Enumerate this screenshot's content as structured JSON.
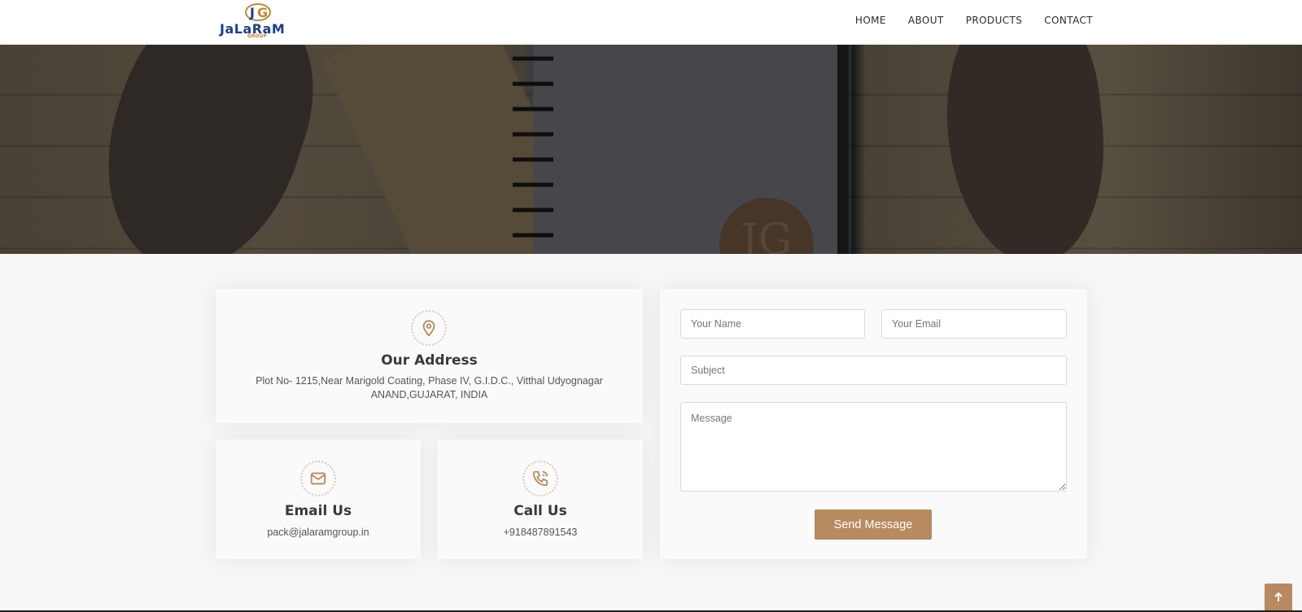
{
  "brand": {
    "name": "JaLaRaM",
    "sub": "GROUP",
    "monogram": "JG"
  },
  "nav": {
    "items": [
      "HOME",
      "ABOUT",
      "PRODUCTS",
      "CONTACT"
    ]
  },
  "hero": {
    "seal_text": "JG"
  },
  "address": {
    "title": "Our Address",
    "text": "Plot No- 1215,Near Marigold Coating, Phase IV, G.I.D.C., Vitthal Udyognagar ANAND,GUJARAT, INDIA",
    "icon": "map-pin-icon"
  },
  "email": {
    "title": "Email Us",
    "text": "pack@jalaramgroup.in",
    "icon": "envelope-icon"
  },
  "call": {
    "title": "Call Us",
    "text": "+918487891543",
    "icon": "phone-icon"
  },
  "form": {
    "name_placeholder": "Your Name",
    "email_placeholder": "Your Email",
    "subject_placeholder": "Subject",
    "message_placeholder": "Message",
    "submit_label": "Send Message"
  },
  "colors": {
    "accent": "#b78a5f",
    "brand_blue": "#1c3f8a",
    "brand_gold": "#c08a2e"
  }
}
